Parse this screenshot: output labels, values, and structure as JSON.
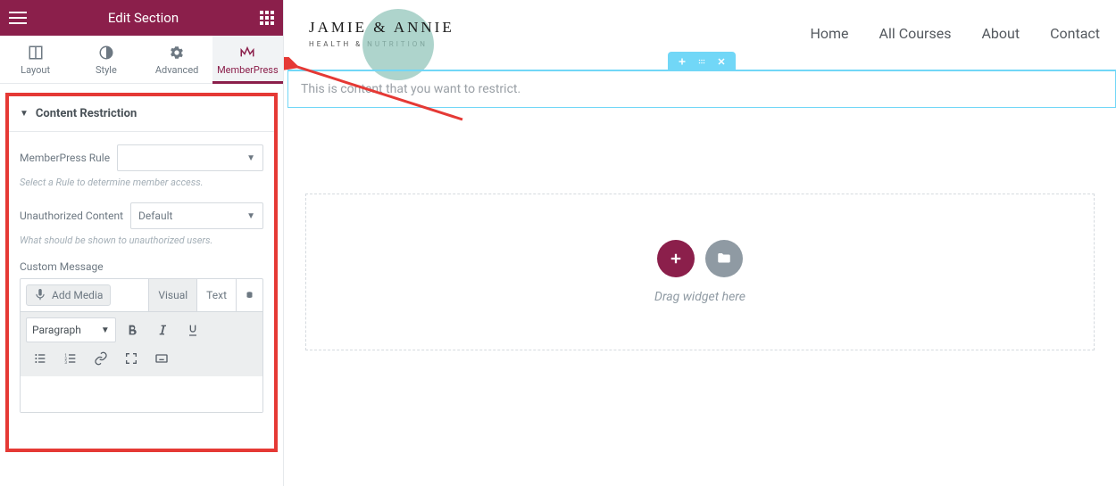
{
  "panel": {
    "title": "Edit Section",
    "tabs": {
      "layout": "Layout",
      "style": "Style",
      "advanced": "Advanced",
      "memberpress": "MemberPress"
    },
    "section": {
      "title": "Content Restriction"
    },
    "controls": {
      "rule_label": "MemberPress Rule",
      "rule_value": "",
      "rule_help": "Select a Rule to determine member access.",
      "unauth_label": "Unauthorized Content",
      "unauth_value": "Default",
      "unauth_help": "What should be shown to unauthorized users.",
      "custom_msg_label": "Custom Message"
    },
    "wysiwyg": {
      "add_media": "Add Media",
      "tab_visual": "Visual",
      "tab_text": "Text",
      "format": "Paragraph"
    }
  },
  "site": {
    "logo_main": "JAMIE & ANNIE",
    "logo_sub": "HEALTH & NUTRITION",
    "nav": {
      "home": "Home",
      "courses": "All Courses",
      "about": "About",
      "contact": "Contact"
    }
  },
  "canvas": {
    "restrict_text": "This is content that you want to restrict.",
    "drop_text": "Drag widget here"
  }
}
